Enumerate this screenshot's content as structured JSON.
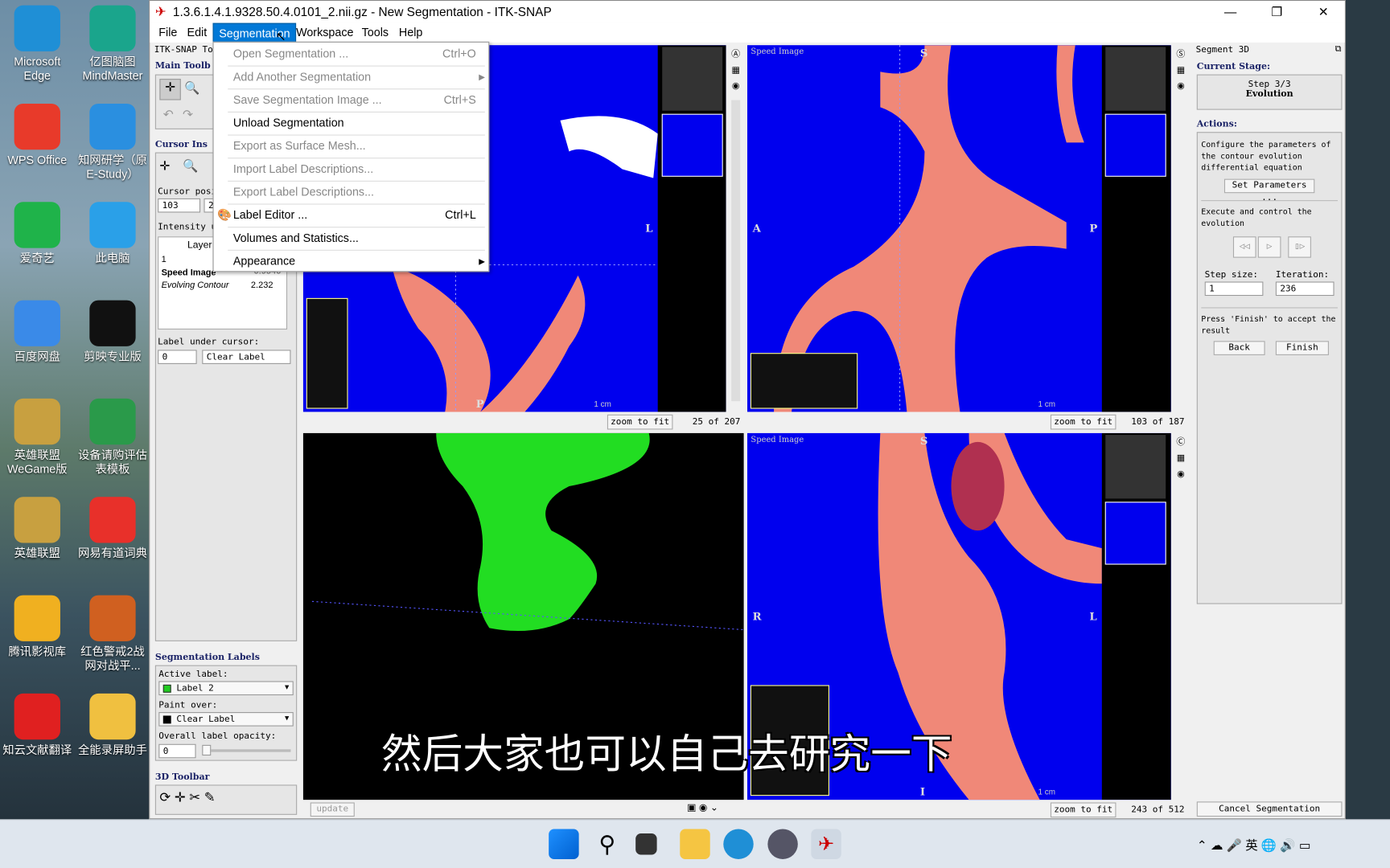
{
  "desktop": {
    "icons": [
      {
        "label": "Microsoft Edge",
        "color": "#1f8fd6"
      },
      {
        "label": "亿图脑图 MindMaster",
        "color": "#1aa58c"
      },
      {
        "label": "WPS Office",
        "color": "#e83a2a"
      },
      {
        "label": "知网研学（原E-Study）",
        "color": "#2a8fe0"
      },
      {
        "label": "爱奇艺",
        "color": "#1fb34a"
      },
      {
        "label": "此电脑",
        "color": "#2aa0e8"
      },
      {
        "label": "百度网盘",
        "color": "#3a8ae8"
      },
      {
        "label": "剪映专业版",
        "color": "#111111"
      },
      {
        "label": "英雄联盟WeGame版",
        "color": "#c8a040"
      },
      {
        "label": "设备请购评估表模板",
        "color": "#2a9a4a"
      },
      {
        "label": "英雄联盟",
        "color": "#c8a040"
      },
      {
        "label": "网易有道词典",
        "color": "#e8302a"
      },
      {
        "label": "腾讯影视库",
        "color": "#f0b020"
      },
      {
        "label": "红色警戒2战网对战平...",
        "color": "#d06020"
      },
      {
        "label": "知云文献翻译",
        "color": "#e02020"
      },
      {
        "label": "全能录屏助手",
        "color": "#f0c040"
      }
    ]
  },
  "window": {
    "title": "1.3.6.1.4.1.9328.50.4.0101_2.nii.gz - New Segmentation - ITK-SNAP"
  },
  "menubar": [
    "File",
    "Edit",
    "Segmentation",
    "Workspace",
    "Tools",
    "Help"
  ],
  "segmentation_menu": [
    {
      "label": "Open Segmentation ...",
      "shortcut": "Ctrl+O",
      "enabled": false
    },
    {
      "label": "Add Another Segmentation",
      "shortcut": "",
      "enabled": false,
      "submenu": true
    },
    {
      "label": "Save Segmentation Image ...",
      "shortcut": "Ctrl+S",
      "enabled": false
    },
    {
      "label": "Unload Segmentation",
      "shortcut": "",
      "enabled": true
    },
    {
      "label": "Export as Surface Mesh...",
      "shortcut": "",
      "enabled": false
    },
    {
      "label": "Import Label Descriptions...",
      "shortcut": "",
      "enabled": false
    },
    {
      "label": "Export Label Descriptions...",
      "shortcut": "",
      "enabled": false
    },
    {
      "label": "Label Editor ...",
      "shortcut": "Ctrl+L",
      "enabled": true,
      "icon": "palette-icon"
    },
    {
      "label": "Volumes and Statistics...",
      "shortcut": "",
      "enabled": true
    },
    {
      "label": "Appearance",
      "shortcut": "",
      "enabled": true,
      "submenu": true
    }
  ],
  "left": {
    "toolbox": "ITK-SNAP To",
    "main_toolbar": "Main Toolb",
    "cursor_inspector": "Cursor Ins",
    "cursor_position_label": "Cursor posi",
    "cursor_x": "103",
    "cursor_y": "2",
    "intensity_label": "Intensity u",
    "layer_header": "Layer",
    "rows": [
      {
        "layer": "1",
        "value": ""
      },
      {
        "layer": "Speed Image",
        "value": "-0.9546"
      },
      {
        "layer": "Evolving Contour",
        "value": "2.232"
      }
    ],
    "label_under_cursor": "Label under cursor:",
    "label_id": "0",
    "label_name": "Clear Label",
    "seg_labels": "Segmentation Labels",
    "active_label": "Active label:",
    "active_value": "Label 2",
    "active_color": "#22cc22",
    "paint_over": "Paint over:",
    "paint_value": "Clear Label",
    "paint_color": "#000000",
    "opacity_label": "Overall label opacity:",
    "opacity_value": "0",
    "toolbar3d": "3D Toolbar"
  },
  "views": {
    "tl": {
      "orient": {
        "left": "",
        "right": "L",
        "bottom": "P"
      },
      "scale": "1 cm",
      "slice": "25 of 207",
      "zoom": "zoom to fit"
    },
    "tr": {
      "layer": "Speed Image",
      "orient": {
        "top": "S",
        "left": "A",
        "right": "P"
      },
      "scale": "1 cm",
      "slice": "103 of 187",
      "zoom": "zoom to fit"
    },
    "br": {
      "layer": "Speed Image",
      "orient": {
        "top": "S",
        "left": "R",
        "right": "L",
        "bottom": "I"
      },
      "scale": "1 cm",
      "slice": "243 of 512",
      "zoom": "zoom to fit"
    },
    "update": "update"
  },
  "right": {
    "title": "Segment 3D",
    "current_stage": "Current Stage:",
    "step": "Step 3/3",
    "stage": "Evolution",
    "actions": "Actions:",
    "configure": "Configure the parameters of the contour evolution differential equation",
    "set_params": "Set Parameters ...",
    "execute": "Execute and control the evolution",
    "step_size_label": "Step size:",
    "step_size": "1",
    "iteration_label": "Iteration:",
    "iteration": "236",
    "press_finish": "Press 'Finish' to accept the result",
    "back": "Back",
    "finish": "Finish",
    "cancel": "Cancel Segmentation"
  },
  "subtitle": "然后大家也可以自己去研究一下",
  "taskbar": {
    "ime": "英"
  }
}
